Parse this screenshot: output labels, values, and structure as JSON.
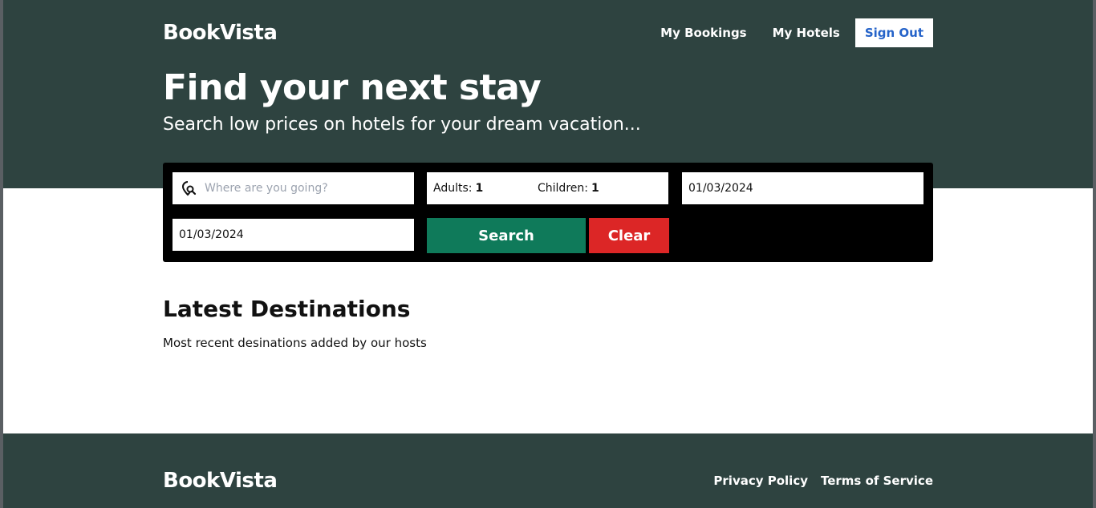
{
  "header": {
    "logo": "BookVista",
    "nav": {
      "my_bookings": "My Bookings",
      "my_hotels": "My Hotels",
      "sign_out": "Sign Out"
    }
  },
  "hero": {
    "title": "Find your next stay",
    "subtitle": "Search low prices on hotels for your dream vacation..."
  },
  "search": {
    "destination_placeholder": "Where are you going?",
    "destination_value": "",
    "adults_label": "Adults:",
    "adults_value": "1",
    "children_label": "Children:",
    "children_value": "1",
    "check_in": "01/03/2024",
    "check_out": "01/03/2024",
    "search_label": "Search",
    "clear_label": "Clear"
  },
  "destinations": {
    "title": "Latest Destinations",
    "subtitle": "Most recent desinations added by our hosts"
  },
  "footer": {
    "logo": "BookVista",
    "privacy": "Privacy Policy",
    "terms": "Terms of Service"
  },
  "colors": {
    "brand_dark": "#2e4340",
    "search_button": "#0f7a5a",
    "clear_button": "#dc2626",
    "sign_out_text": "#2563c9"
  },
  "icons": {
    "destination": "location-search-icon"
  }
}
